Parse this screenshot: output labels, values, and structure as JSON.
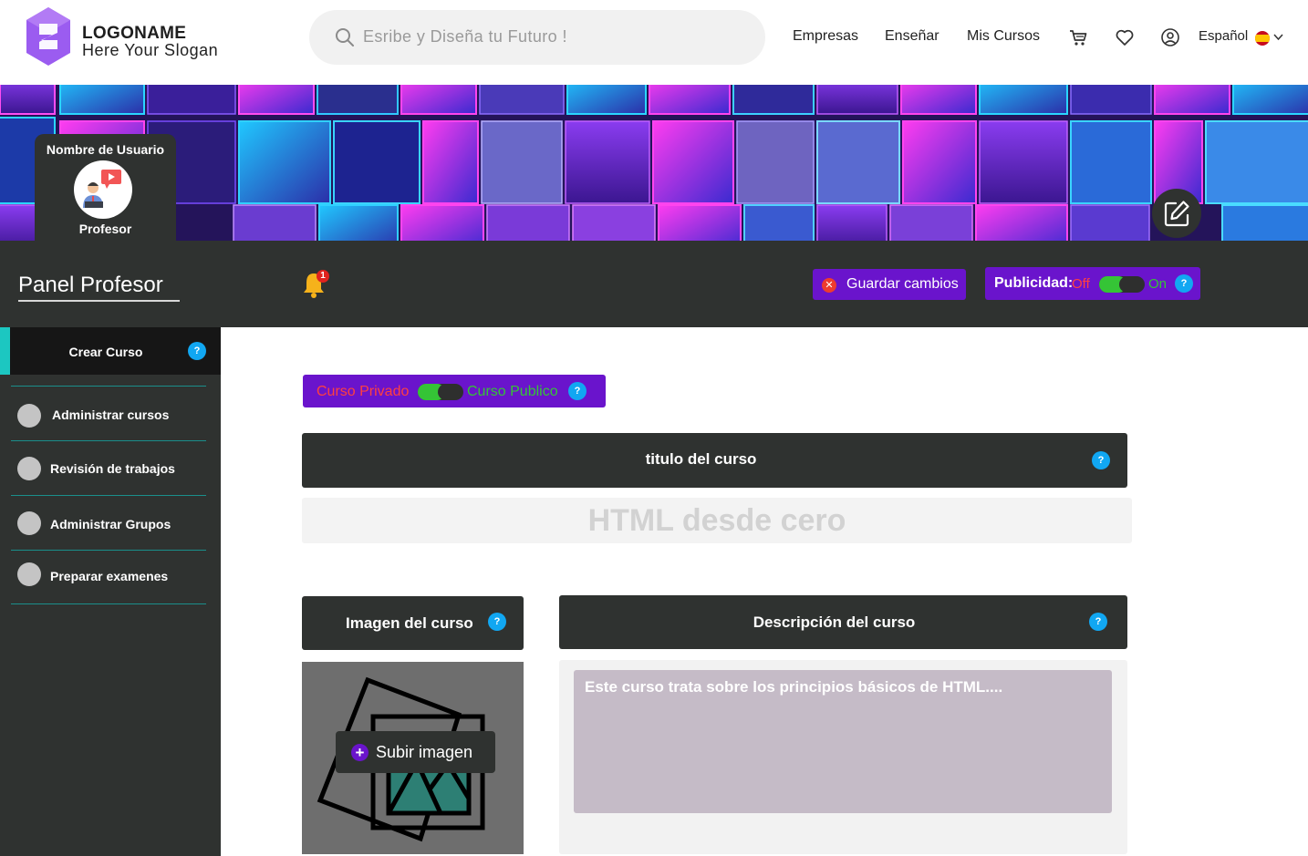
{
  "header": {
    "logo_name": "LOGONAME",
    "logo_slogan": "Here Your Slogan",
    "search_placeholder": "Esribe y Diseña tu Futuro !",
    "nav": [
      "Empresas",
      "Enseñar",
      "Mis Cursos"
    ],
    "icons": [
      "cart-icon",
      "heart-icon",
      "user-icon"
    ],
    "language": "Español",
    "language_flag": "spain-flag-icon"
  },
  "profile": {
    "name": "Nombre de Usuario",
    "role": "Profesor"
  },
  "panel": {
    "title": "Panel Profesor",
    "notification_count": "1",
    "save_label": "Guardar cambios",
    "advertising_label": "Publicidad:",
    "advertising_off": "Off",
    "advertising_on": "On",
    "help": "?"
  },
  "sidebar": {
    "active_item": "Crear Curso",
    "items": [
      {
        "label": "Administrar cursos"
      },
      {
        "label": "Revisión de trabajos"
      },
      {
        "label": "Administrar Grupos"
      },
      {
        "label": "Preparar examenes"
      }
    ]
  },
  "course": {
    "private_label": "Curso Privado",
    "public_label": "Curso Publico",
    "title_header": "titulo del curso",
    "title_value": "HTML desde cero",
    "image_header": "Imagen del curso",
    "upload_label": "Subir imagen",
    "description_header": "Descripción del curso",
    "description_value": "Este curso trata sobre los principios básicos de HTML...."
  },
  "colors": {
    "dark": "#2f3230",
    "purple": "#6a14cc",
    "accent_teal": "#1cc7c1",
    "help_blue": "#11a7f2",
    "off_red": "#ff4040",
    "on_green": "#35c436"
  }
}
